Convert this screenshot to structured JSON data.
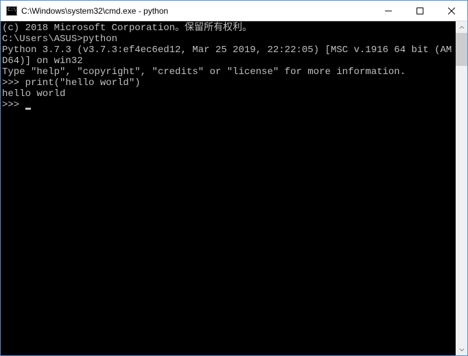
{
  "window": {
    "title": "C:\\Windows\\system32\\cmd.exe - python"
  },
  "terminal": {
    "lines": [
      "(c) 2018 Microsoft Corporation。保留所有权利。",
      "",
      "C:\\Users\\ASUS>python",
      "Python 3.7.3 (v3.7.3:ef4ec6ed12, Mar 25 2019, 22:22:05) [MSC v.1916 64 bit (AMD64)] on win32",
      "Type \"help\", \"copyright\", \"credits\" or \"license\" for more information.",
      ">>> print(\"hello world\")",
      "hello world",
      ">>> "
    ]
  }
}
